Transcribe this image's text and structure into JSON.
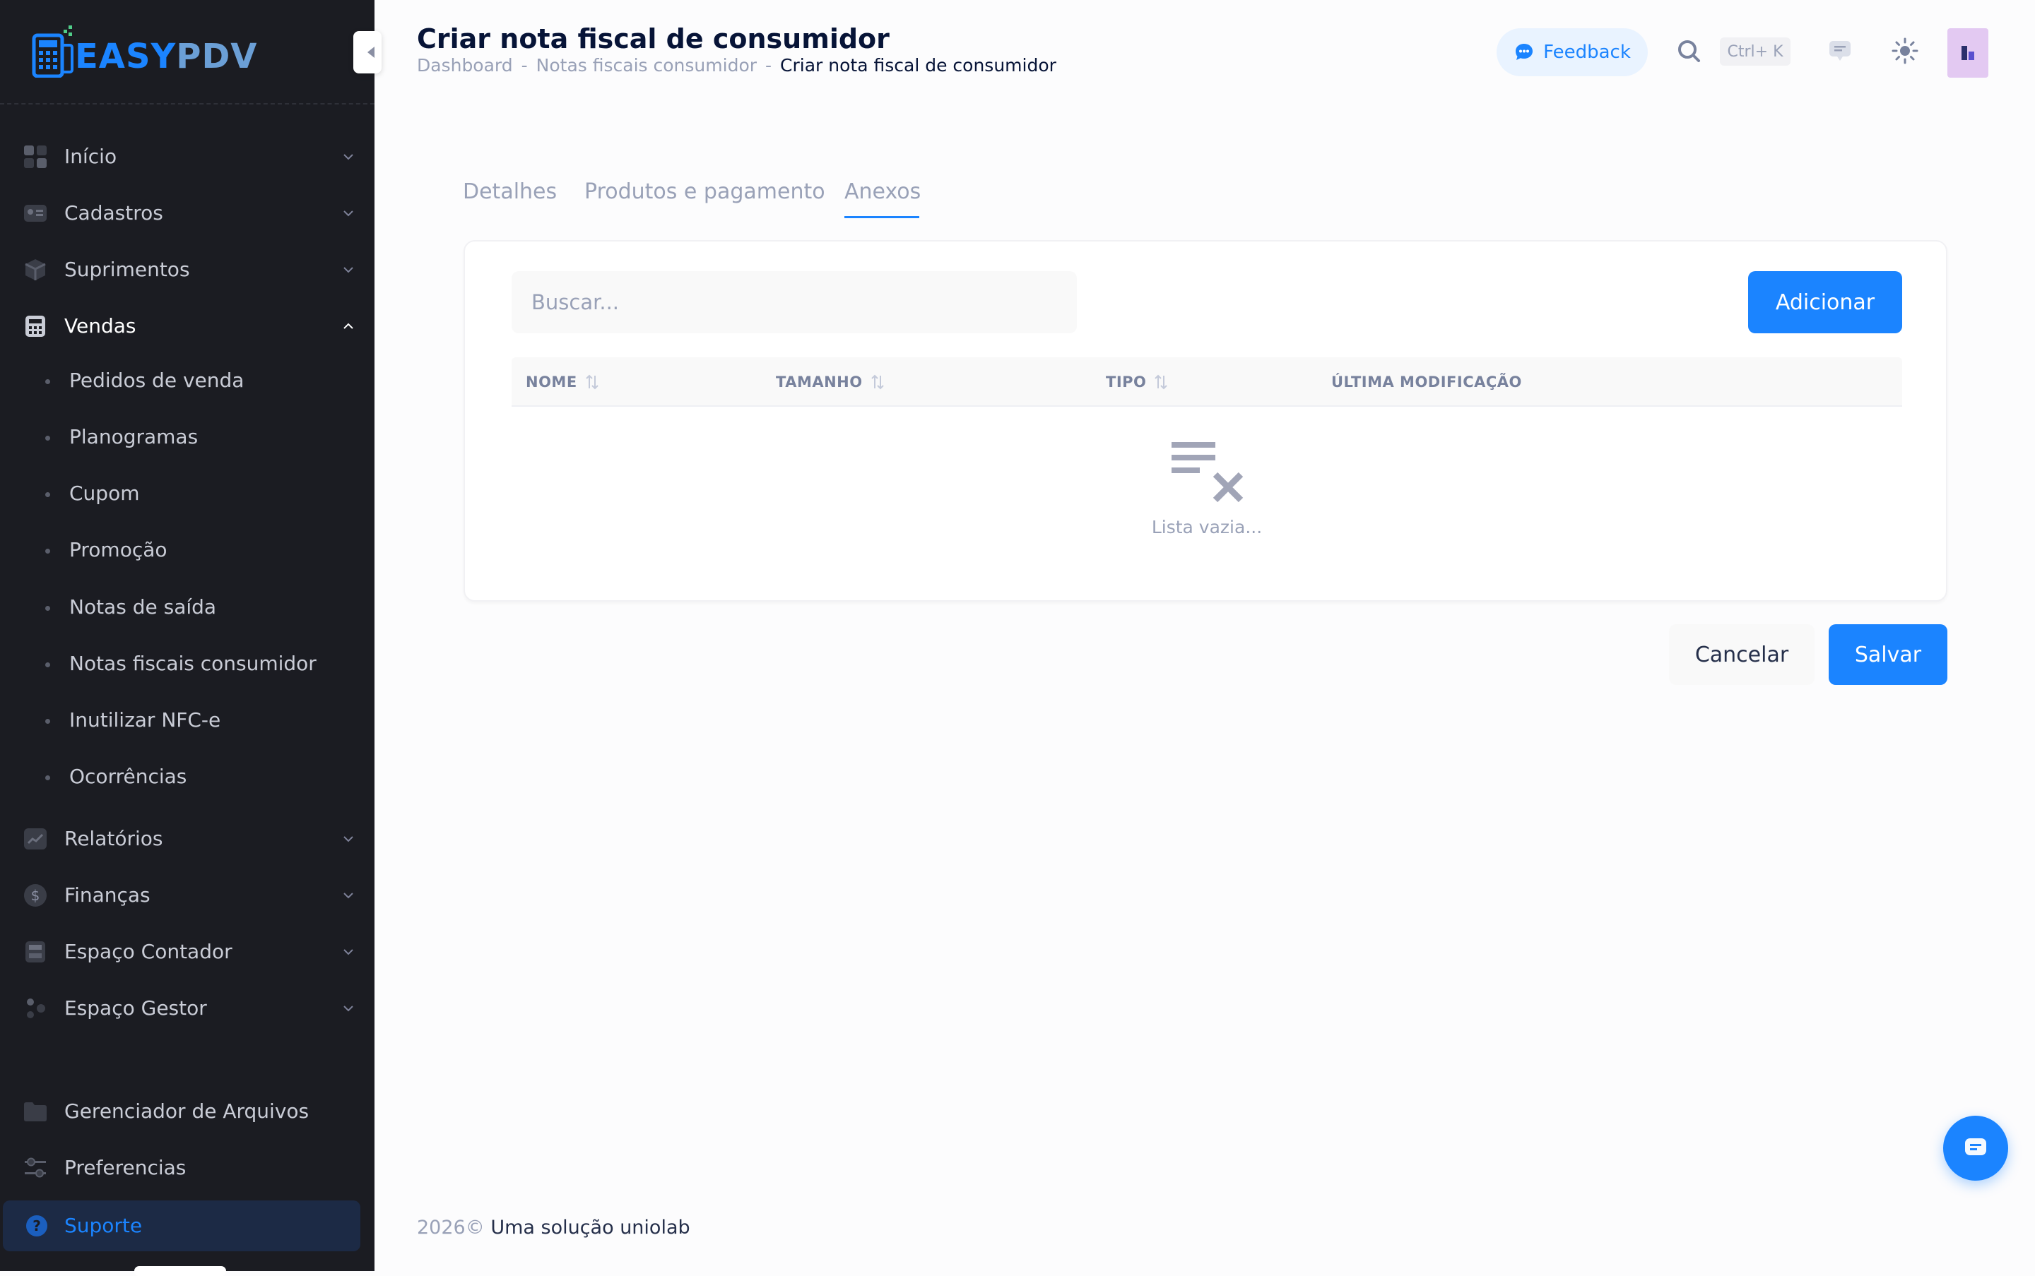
{
  "brand": {
    "easy": "EASY",
    "pdv": "PDV",
    "accent": "#1b84ff"
  },
  "sidebar": {
    "items": [
      {
        "label": "Início",
        "icon": "grid-icon"
      },
      {
        "label": "Cadastros",
        "icon": "id-card-icon"
      },
      {
        "label": "Suprimentos",
        "icon": "box-icon"
      },
      {
        "label": "Vendas",
        "icon": "calculator-icon",
        "expanded": true
      },
      {
        "label": "Relatórios",
        "icon": "chart-icon"
      },
      {
        "label": "Finanças",
        "icon": "dollar-icon"
      },
      {
        "label": "Espaço Contador",
        "icon": "calculator-icon"
      },
      {
        "label": "Espaço Gestor",
        "icon": "people-icon"
      }
    ],
    "vendas_children": [
      "Pedidos de venda",
      "Planogramas",
      "Cupom",
      "Promoção",
      "Notas de saída",
      "Notas fiscais consumidor",
      "Inutilizar NFC-e",
      "Ocorrências"
    ],
    "bottom": [
      {
        "label": "Gerenciador de Arquivos",
        "icon": "folder-icon"
      },
      {
        "label": "Preferencias",
        "icon": "sliders-icon"
      }
    ],
    "support": {
      "label": "Suporte",
      "icon": "question-icon"
    }
  },
  "header": {
    "title": "Criar nota fiscal de consumidor",
    "breadcrumb": [
      "Dashboard",
      "Notas fiscais consumidor",
      "Criar nota fiscal de consumidor"
    ],
    "separator": "-",
    "feedback_label": "Feedback",
    "shortcut": "Ctrl+ K"
  },
  "tabs": [
    {
      "label": "Detalhes"
    },
    {
      "label": "Produtos e pagamento"
    },
    {
      "label": "Anexos",
      "active": true
    }
  ],
  "attachments": {
    "search_placeholder": "Buscar...",
    "add_label": "Adicionar",
    "columns": [
      "NOME",
      "TAMANHO",
      "TIPO",
      "ÚLTIMA MODIFICAÇÃO"
    ],
    "rows": [],
    "empty_text": "Lista vazia..."
  },
  "actions": {
    "cancel_label": "Cancelar",
    "save_label": "Salvar"
  },
  "footer": {
    "year": "2026©",
    "credit": "Uma solução uniolab"
  }
}
